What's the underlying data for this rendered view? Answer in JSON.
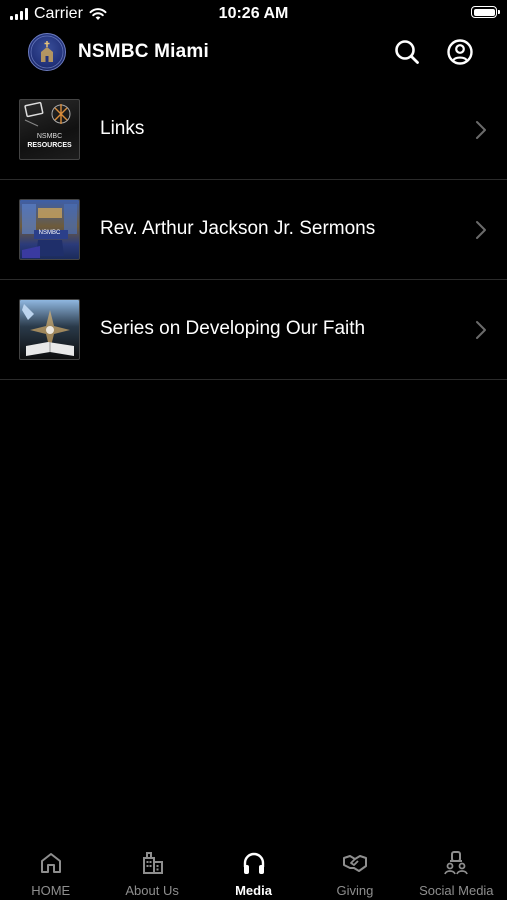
{
  "status_bar": {
    "carrier": "Carrier",
    "time": "10:26 AM"
  },
  "header": {
    "title": "NSMBC Miami"
  },
  "media_items": [
    {
      "label": "Links",
      "thumb_text_1": "NSMBC",
      "thumb_text_2": "RESOURCES"
    },
    {
      "label": "Rev. Arthur Jackson Jr. Sermons",
      "thumb_text_1": "NSMBC"
    },
    {
      "label": "Series on Developing Our Faith"
    }
  ],
  "tabs": [
    {
      "label": "HOME",
      "icon": "home-icon",
      "active": false
    },
    {
      "label": "About Us",
      "icon": "building-icon",
      "active": false
    },
    {
      "label": "Media",
      "icon": "headphones-icon",
      "active": true
    },
    {
      "label": "Giving",
      "icon": "handshake-icon",
      "active": false
    },
    {
      "label": "Social Media",
      "icon": "people-icon",
      "active": false
    }
  ],
  "colors": {
    "background": "#000000",
    "text": "#ffffff",
    "inactive_tab": "#8e8e8e",
    "divider": "#2b2b2b"
  }
}
